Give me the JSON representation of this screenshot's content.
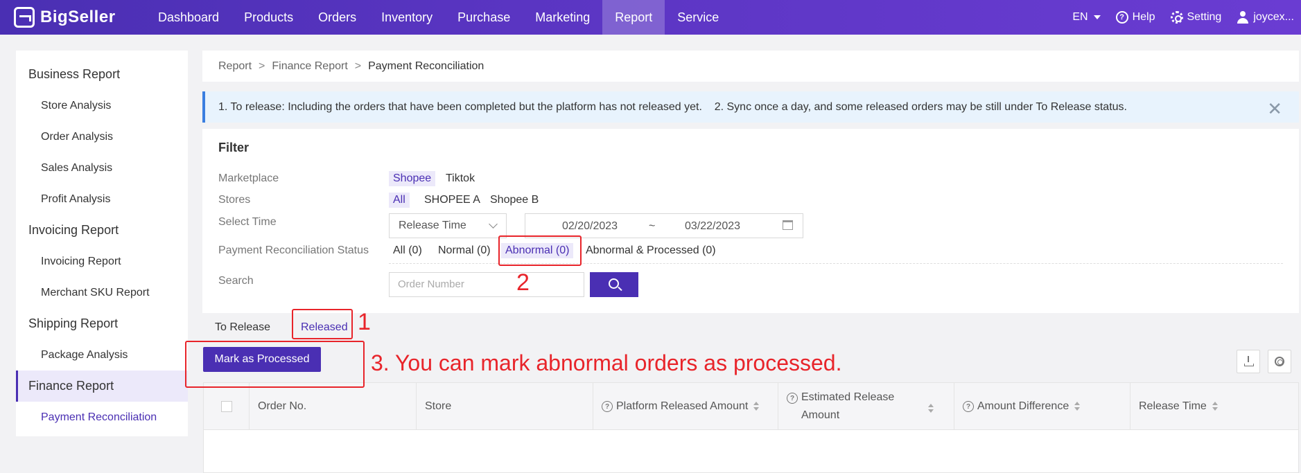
{
  "header": {
    "brand": "BigSeller",
    "nav": [
      "Dashboard",
      "Products",
      "Orders",
      "Inventory",
      "Purchase",
      "Marketing",
      "Report",
      "Service"
    ],
    "active_nav": "Report",
    "lang": "EN",
    "help": "Help",
    "setting": "Setting",
    "user": "joycex..."
  },
  "sidebar": {
    "groups": [
      {
        "label": "Business Report",
        "items": [
          "Store Analysis",
          "Order Analysis",
          "Sales Analysis",
          "Profit Analysis"
        ]
      },
      {
        "label": "Invoicing Report",
        "items": [
          "Invoicing Report",
          "Merchant SKU Report"
        ]
      },
      {
        "label": "Shipping Report",
        "items": [
          "Package Analysis"
        ]
      },
      {
        "label": "Finance Report",
        "items": [
          "Payment Reconciliation"
        ]
      }
    ]
  },
  "breadcrumb": {
    "items": [
      "Report",
      "Finance Report",
      "Payment Reconciliation"
    ],
    "sep": ">"
  },
  "notice": {
    "text": "1. To release: Including the orders that have been completed but the platform has not released yet.    2. Sync once a day, and some released orders may be still under To Release status.",
    "close": "✕"
  },
  "filter": {
    "title": "Filter",
    "marketplace": {
      "label": "Marketplace",
      "options": [
        "Shopee",
        "Tiktok"
      ],
      "selected": "Shopee"
    },
    "stores": {
      "label": "Stores",
      "options": [
        "All",
        "SHOPEE A",
        "Shopee B"
      ],
      "selected": "All"
    },
    "time": {
      "label": "Select Time",
      "type": "Release Time",
      "start": "02/20/2023",
      "tilde": "~",
      "end": "03/22/2023"
    },
    "status": {
      "label": "Payment Reconciliation Status",
      "options": [
        "All (0)",
        "Normal (0)",
        "Abnormal (0)",
        "Abnormal & Processed (0)"
      ],
      "selected": "Abnormal (0)"
    },
    "search": {
      "label": "Search",
      "placeholder": "Order Number"
    }
  },
  "tabs": [
    "To Release",
    "Released"
  ],
  "active_tab": "Released",
  "mark_button": "Mark as Processed",
  "table": {
    "columns": [
      "Order No.",
      "Store",
      "Platform Released Amount",
      "Estimated Release Amount",
      "Amount Difference",
      "Release Time"
    ]
  },
  "annotations": [
    "1",
    "2",
    "3. You can mark abnormal orders as processed."
  ],
  "colors": {
    "primary": "#4a2fb3",
    "annotation": "#e8242a",
    "notice_bg": "#e8f3fd"
  }
}
